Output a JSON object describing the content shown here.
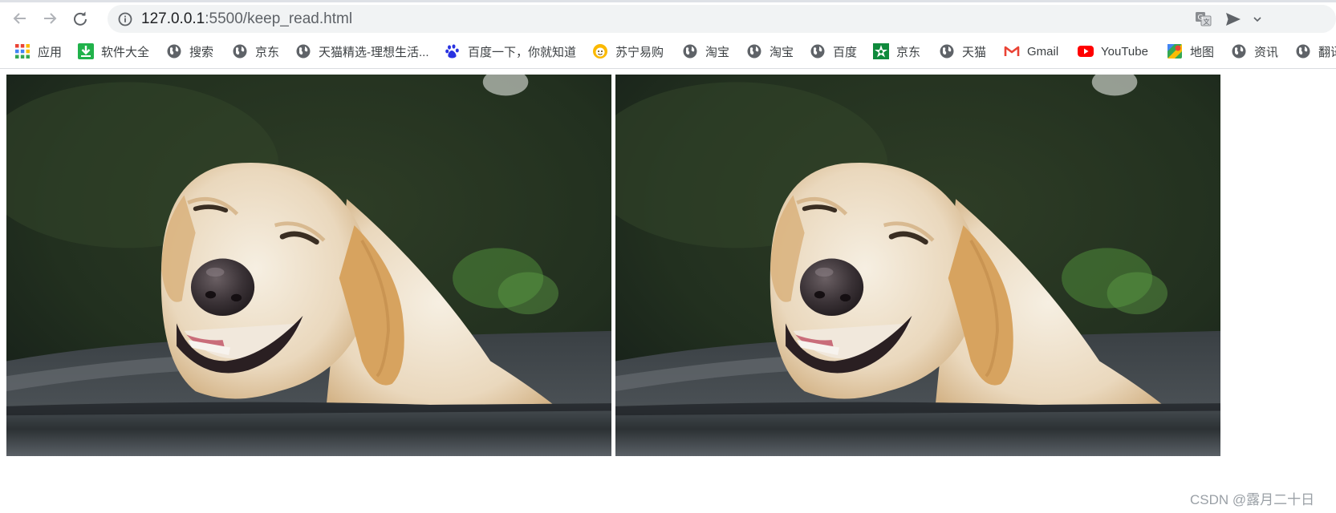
{
  "browser": {
    "url_host": "127.0.0.1",
    "url_rest": ":5500/keep_read.html",
    "nav_icons": [
      "back-arrow-icon",
      "forward-arrow-icon",
      "reload-icon"
    ],
    "omnibox_icons": [
      "site-info-icon",
      "translate-icon",
      "send-icon"
    ]
  },
  "bookmarks": [
    {
      "label": "应用",
      "icon": "apps-grid-icon"
    },
    {
      "label": "软件大全",
      "icon": "download-icon"
    },
    {
      "label": "搜索",
      "icon": "globe-icon"
    },
    {
      "label": "京东",
      "icon": "globe-icon"
    },
    {
      "label": "天猫精选-理想生活...",
      "icon": "globe-icon"
    },
    {
      "label": "百度一下，你就知道",
      "icon": "baidu-paw-icon"
    },
    {
      "label": "苏宁易购",
      "icon": "suning-icon"
    },
    {
      "label": "淘宝",
      "icon": "globe-icon"
    },
    {
      "label": "淘宝",
      "icon": "globe-icon"
    },
    {
      "label": "百度",
      "icon": "globe-icon"
    },
    {
      "label": "京东",
      "icon": "green-star-icon"
    },
    {
      "label": "天猫",
      "icon": "globe-icon"
    },
    {
      "label": "Gmail",
      "icon": "gmail-icon"
    },
    {
      "label": "YouTube",
      "icon": "youtube-icon"
    },
    {
      "label": "地图",
      "icon": "maps-icon"
    },
    {
      "label": "资讯",
      "icon": "globe-icon"
    },
    {
      "label": "翻译",
      "icon": "globe-icon"
    }
  ],
  "page": {
    "images": [
      {
        "subject": "smiling yellow labrador dog"
      },
      {
        "subject": "smiling yellow labrador dog"
      }
    ],
    "watermark": "CSDN @露月二十日"
  }
}
